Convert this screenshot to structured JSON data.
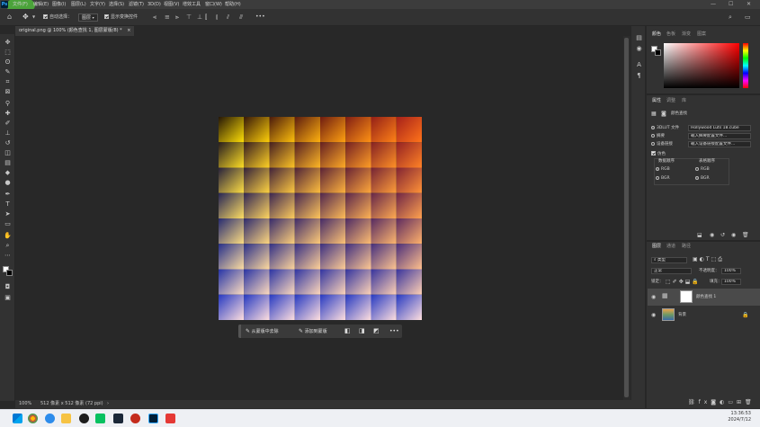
{
  "menubar": {
    "items": [
      "文件(F)",
      "编辑(E)",
      "图像(I)",
      "图层(L)",
      "文字(Y)",
      "选择(S)",
      "滤镜(T)",
      "3D(D)",
      "视图(V)",
      "增效工具",
      "窗口(W)",
      "帮助(H)"
    ],
    "window_controls": [
      "—",
      "☐",
      "✕"
    ]
  },
  "options": {
    "auto_select_label": "自动选择：",
    "auto_select_value": "图层",
    "show_transform_label": "显示变换控件",
    "more": "•••"
  },
  "document": {
    "tab_title": "original.png @ 100% (颜色查找 1, 图层蒙版/8) *",
    "tab_close": "×"
  },
  "status": {
    "zoom": "100%",
    "size": "512 像素 x 512 像素 (72 ppi)"
  },
  "context_bar": {
    "select_subject": "从蒙版中去除",
    "add_to_mask": "添加到蒙版",
    "more": "•••"
  },
  "color_panel": {
    "tabs": [
      "颜色",
      "色板",
      "渐变",
      "图案"
    ]
  },
  "properties_panel": {
    "tabs": [
      "属性",
      "调整",
      "库"
    ],
    "header": "颜色查找",
    "lut_label": "3DLUT 文件",
    "lut_value": "Hollywood Luts 18.cube",
    "abstract_label": "摘要",
    "abstract_value": "载入摘要配置文件...",
    "devicelink_label": "设备链接",
    "devicelink_value": "载入设备链接配置文件...",
    "dither_label": "仿色",
    "data_order_label": "数据顺序",
    "table_order_label": "表格顺序",
    "rgb": "RGB",
    "bgr": "BGR"
  },
  "layers_panel": {
    "tabs": [
      "图层",
      "通道",
      "路径"
    ],
    "filter_kind": "类型",
    "blend_mode": "正常",
    "opacity_label": "不透明度：",
    "opacity_value": "100%",
    "lock_label": "锁定：",
    "fill_label": "填充：",
    "fill_value": "100%",
    "layers": [
      {
        "name": "颜色查找 1"
      },
      {
        "name": "背景"
      }
    ]
  },
  "taskbar": {
    "time": "13:36:53",
    "date": "2024/7/12"
  },
  "colors": {
    "accent_green": "#4cae3a",
    "ps_blue": "#31a8ff"
  }
}
